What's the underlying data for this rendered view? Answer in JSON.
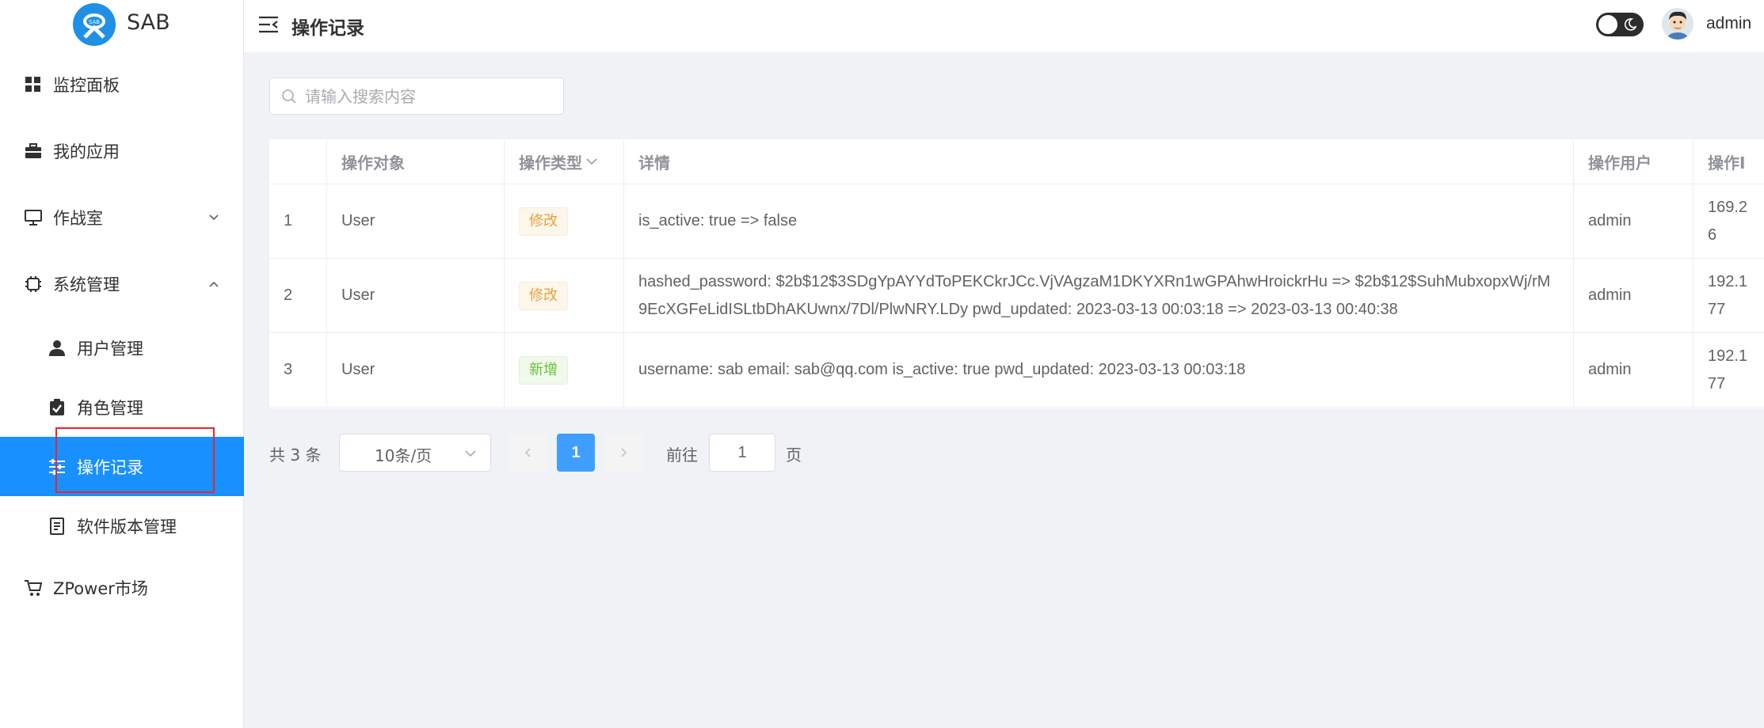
{
  "app": {
    "logo_text": "SAB"
  },
  "colors": {
    "accent": "#1890ff",
    "highlight": "#e8262d",
    "tag_modify": "#e6a23c",
    "tag_add": "#67c23a"
  },
  "sidebar": {
    "items": [
      {
        "label": "监控面板",
        "icon": "dashboard-icon"
      },
      {
        "label": "我的应用",
        "icon": "briefcase-icon"
      },
      {
        "label": "作战室",
        "icon": "monitor-icon",
        "expanded": false
      },
      {
        "label": "系统管理",
        "icon": "chip-icon",
        "expanded": true
      },
      {
        "label": "ZPower市场",
        "icon": "cart-icon"
      }
    ],
    "sub_items": [
      {
        "label": "用户管理",
        "icon": "user-icon"
      },
      {
        "label": "角色管理",
        "icon": "clipboard-check-icon"
      },
      {
        "label": "操作记录",
        "icon": "sliders-icon",
        "active": true
      },
      {
        "label": "软件版本管理",
        "icon": "document-icon"
      }
    ]
  },
  "header": {
    "title": "操作记录",
    "username": "admin"
  },
  "search": {
    "placeholder": "请输入搜索内容",
    "value": ""
  },
  "table": {
    "columns": [
      "",
      "操作对象",
      "操作类型",
      "详情",
      "操作用户",
      "操作I"
    ],
    "rows": [
      {
        "index": "1",
        "object": "User",
        "type": "修改",
        "type_kind": "modify",
        "detail": "is_active: true => false",
        "user": "admin",
        "ip": "169.2​6"
      },
      {
        "index": "2",
        "object": "User",
        "type": "修改",
        "type_kind": "modify",
        "detail": "hashed_password: $2b$12$3SDgYpAYYdToPEKCkrJCc.VjVAgzaM1DKYXRn1wGPAhwHroickrHu => $2b$12$SuhMubxopxWj/rM9EcXGFeLidISLtbDhAKUwnx/7Dl/PlwNRY.LDy pwd_updated: 2023-03-13 00:03:18 => 2023-03-13 00:40:38",
        "user": "admin",
        "ip": "192.1​77"
      },
      {
        "index": "3",
        "object": "User",
        "type": "新增",
        "type_kind": "add",
        "detail": "username: sab email: sab@qq.com is_active: true pwd_updated: 2023-03-13 00:03:18",
        "user": "admin",
        "ip": "192.1​77"
      }
    ]
  },
  "pagination": {
    "total": "共 3 条",
    "page_size": "10条/页",
    "current_page": "1",
    "goto_label": "前往",
    "goto_value": "1",
    "page_suffix": "页"
  }
}
